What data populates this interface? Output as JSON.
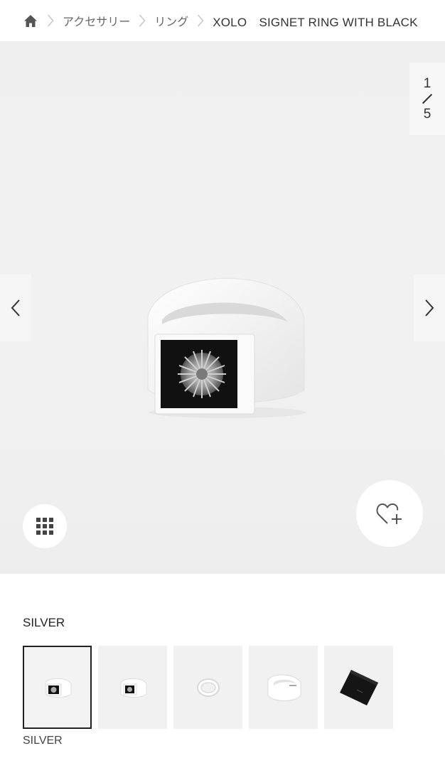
{
  "breadcrumb": {
    "home_icon": "home-icon",
    "items": [
      "アクセサリー",
      "リング"
    ],
    "current": "XOLO　SIGNET RING WITH BLACK"
  },
  "gallery": {
    "counter": {
      "current": "1",
      "total": "5"
    },
    "prev_icon": "chevron-left-icon",
    "next_icon": "chevron-right-icon",
    "grid_icon": "grid-icon",
    "favorite_icon": "heart-plus-icon"
  },
  "colors": {
    "title": "SILVER",
    "selected_label": "SILVER",
    "selected_index": 0,
    "thumbnail_count": 5
  }
}
